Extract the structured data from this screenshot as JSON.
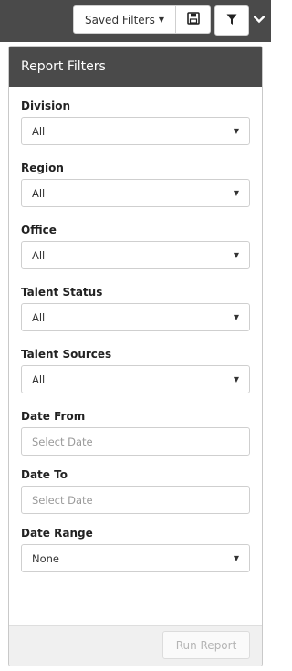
{
  "toolbar": {
    "saved_filters_label": "Saved Filters",
    "save_icon": "floppy-disk-icon",
    "filter_icon": "funnel-icon",
    "menu_icon": "chevron-down-icon"
  },
  "panel": {
    "title": "Report Filters",
    "fields": [
      {
        "label": "Division",
        "type": "select",
        "value": "All"
      },
      {
        "label": "Region",
        "type": "select",
        "value": "All"
      },
      {
        "label": "Office",
        "type": "select",
        "value": "All"
      },
      {
        "label": "Talent Status",
        "type": "select",
        "value": "All"
      },
      {
        "label": "Talent Sources",
        "type": "select",
        "value": "All"
      },
      {
        "label": "Date From",
        "type": "date",
        "placeholder": "Select Date"
      },
      {
        "label": "Date To",
        "type": "date",
        "placeholder": "Select Date"
      },
      {
        "label": "Date Range",
        "type": "select",
        "value": "None"
      }
    ],
    "run_button_label": "Run Report"
  },
  "colors": {
    "header_bg": "#4a4a4a",
    "footer_bg": "#f0f0f0",
    "border": "#cfcfcf"
  }
}
